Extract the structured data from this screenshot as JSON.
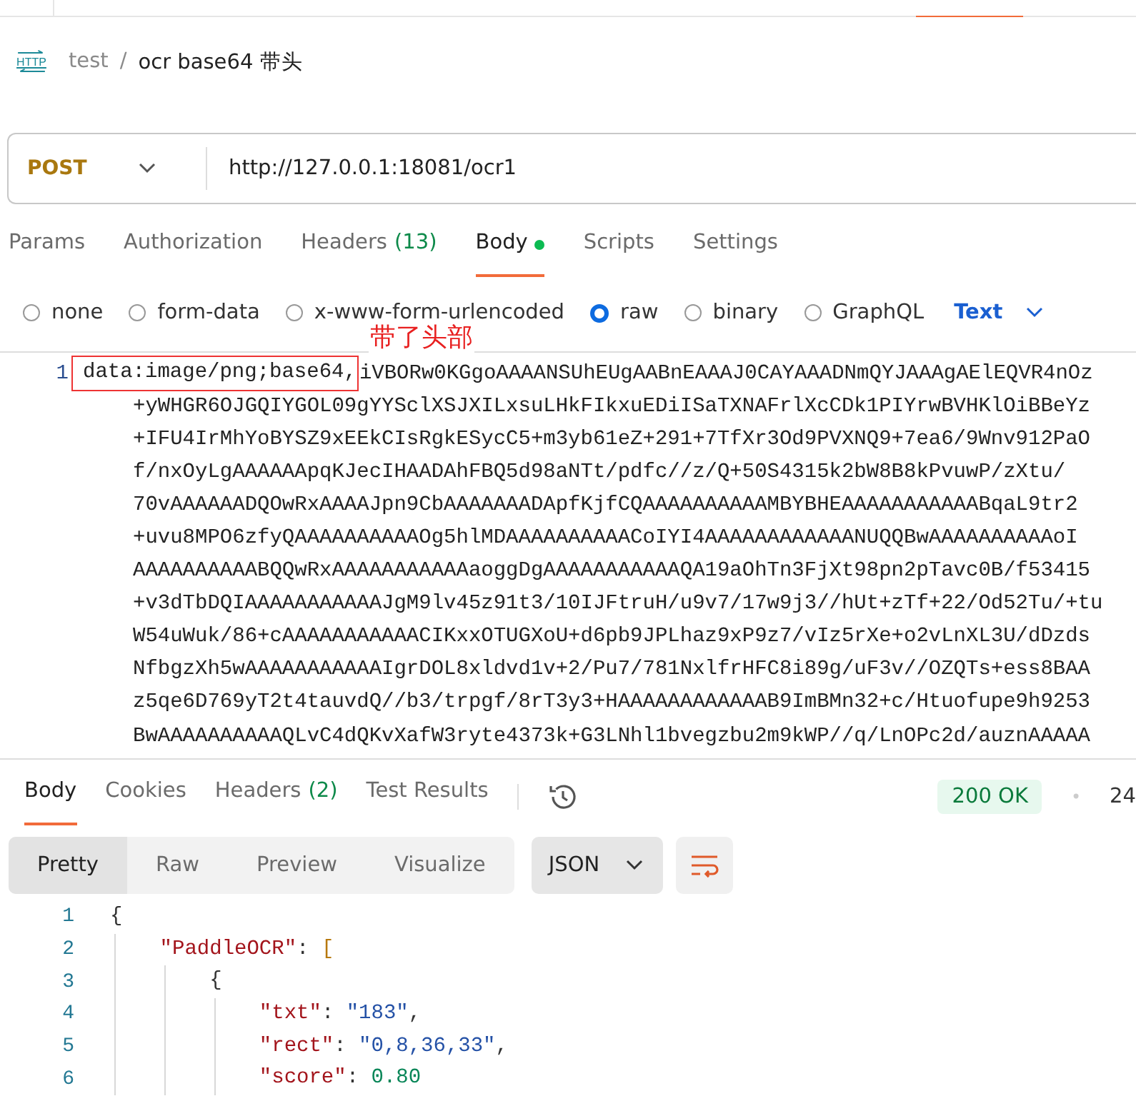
{
  "breadcrumb": {
    "icon_label": "HTTP",
    "collection": "test",
    "separator": "/",
    "request": "ocr base64 带头"
  },
  "request": {
    "method": "POST",
    "url": "http://127.0.0.1:18081/ocr1"
  },
  "request_tabs": [
    {
      "label": "Params",
      "selected": false,
      "has_content": false
    },
    {
      "label": "Authorization",
      "selected": false,
      "has_content": false
    },
    {
      "label": "Headers",
      "count": "(13)",
      "selected": false,
      "has_content": false
    },
    {
      "label": "Body",
      "selected": true,
      "has_content": true
    },
    {
      "label": "Scripts",
      "selected": false,
      "has_content": false
    },
    {
      "label": "Settings",
      "selected": false,
      "has_content": false
    }
  ],
  "body_modes": [
    {
      "label": "none",
      "selected": false
    },
    {
      "label": "form-data",
      "selected": false
    },
    {
      "label": "x-www-form-urlencoded",
      "selected": false
    },
    {
      "label": "raw",
      "selected": true
    },
    {
      "label": "binary",
      "selected": false
    },
    {
      "label": "GraphQL",
      "selected": false
    }
  ],
  "raw_format": "Text",
  "request_body": {
    "line_number": "1",
    "highlighted_prefix": "data:image/png;base64,",
    "annotation": "带了头部",
    "first_line_rest": "iVBORw0KGgoAAAANSUhEUgAABnEAAAJ0CAYAAADNmQYJAAAgAElEQVR4nOz",
    "wrapped_lines": [
      "+yWHGR6OJGQIYGOL09gYYSclXSJXILxsuLHkFIkxuEDiISaTXNAFrlXcCDk1PIYrwBVHKlOiBBeYz",
      "+IFU4IrMhYoBYSZ9xEEkCIsRgkESycC5+m3yb61eZ+291+7TfXr3Od9PVXNQ9+7ea6/9Wnv912PaO",
      "f/nxOyLgAAAAAApqKJecIHAADAhFBQ5d98aNTt/pdfc//z/Q+50S4315k2bW8B8kPvuwP/zXtu/",
      "70vAAAAAADQOwRxAAAAJpn9CbAAAAAAADApfKjfCQAAAAAAAAAAMBYBHEAAAAAAAAAAABqaL9tr2",
      "+uvu8MPO6zfyQAAAAAAAAAAOg5hlMDAAAAAAAAAACoIYI4AAAAAAAAAAAANUQQBwAAAAAAAAAAoI",
      "AAAAAAAAAABQQwRxAAAAAAAAAAAaoggDgAAAAAAAAAAAQA19aOhTn3FjXt98pn2pTavc0B/f53415",
      "+v3dTbDQIAAAAAAAAAAAJgM9lv45z91t3/10IJFtruH/u9v7/17w9j3//hUt+zTf+22/Od52Tu/+tu",
      "W54uWuk/86+cAAAAAAAAAAACIKxxOTUGXoU+d6pb9JPLhaz9xP9z7/vIz5rXe+o2vLnXL3U/dDzds",
      "NfbgzXh5wAAAAAAAAAAAIgrDOL8xldvd1v+2/Pu7/781NxlfrHFC8i89g/uF3v//OZQTs+ess8BAA",
      "z5qe6D769yT2t4tauvdQ//b3/trpgf/8rT3y3+HAAAAAAAAAAAAB9ImBMn32+c/Htuofupe9h9253",
      "BwAAAAAAAAAAQLvC4dQKvXafW3ryte4373k+G3LNhl1bvegzbu2m9kWP//q/LnOPc2d/auznAAAAA"
    ]
  },
  "response_tabs": [
    {
      "label": "Body",
      "selected": true
    },
    {
      "label": "Cookies",
      "selected": false
    },
    {
      "label": "Headers",
      "count": "(2)",
      "selected": false
    },
    {
      "label": "Test Results",
      "selected": false
    }
  ],
  "status": "200 OK",
  "separator": "•",
  "size": "24",
  "view_modes": [
    {
      "label": "Pretty",
      "selected": true
    },
    {
      "label": "Raw",
      "selected": false
    },
    {
      "label": "Preview",
      "selected": false
    },
    {
      "label": "Visualize",
      "selected": false
    }
  ],
  "language": "JSON",
  "response_body": [
    {
      "number": "1",
      "tokens": [
        {
          "kind": "bracket",
          "text": "{"
        }
      ]
    },
    {
      "number": "2",
      "tokens": [
        {
          "kind": "key",
          "text": "    \"PaddleOCR\""
        },
        {
          "kind": "punct",
          "text": ": "
        },
        {
          "kind": "bracket2",
          "text": "["
        }
      ]
    },
    {
      "number": "3",
      "tokens": [
        {
          "kind": "bracket",
          "text": "        {"
        }
      ]
    },
    {
      "number": "4",
      "tokens": [
        {
          "kind": "key",
          "text": "            \"txt\""
        },
        {
          "kind": "punct",
          "text": ": "
        },
        {
          "kind": "string",
          "text": "\"183\""
        },
        {
          "kind": "punct",
          "text": ","
        }
      ]
    },
    {
      "number": "5",
      "tokens": [
        {
          "kind": "key",
          "text": "            \"rect\""
        },
        {
          "kind": "punct",
          "text": ": "
        },
        {
          "kind": "string",
          "text": "\"0,8,36,33\""
        },
        {
          "kind": "punct",
          "text": ","
        }
      ]
    },
    {
      "number": "6",
      "tokens": [
        {
          "kind": "key",
          "text": "            \"score\""
        },
        {
          "kind": "punct",
          "text": ": "
        },
        {
          "kind": "number",
          "text": "0.80"
        }
      ]
    }
  ]
}
